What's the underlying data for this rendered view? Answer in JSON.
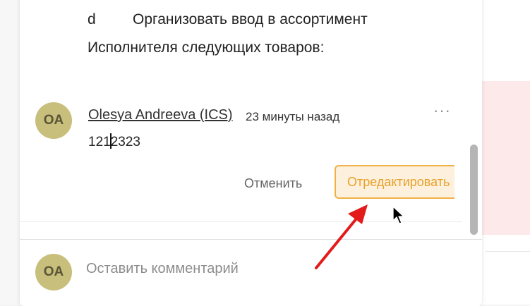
{
  "document": {
    "letter": "d",
    "task": "Организовать ввод в ассортимент",
    "line2": "Исполнителя следующих товаров:"
  },
  "comment": {
    "avatar_initials": "OA",
    "author": "Olesya Andreeva (ICS)",
    "time": "23 минуты назад",
    "more": "···",
    "edit_value_before_caret": "121",
    "edit_value_after_caret": "2323"
  },
  "actions": {
    "cancel_label": "Отменить",
    "edit_label": "Отредактировать"
  },
  "new_comment": {
    "avatar_initials": "OA",
    "placeholder": "Оставить комментарий"
  },
  "colors": {
    "accent": "#f0b14a",
    "accent_text": "#e8a12c",
    "avatar_bg": "#c8bf7c",
    "annotation_arrow": "#e31b1b"
  },
  "icons": [
    "more-options-icon",
    "mouse-cursor-icon",
    "annotation-arrow-icon"
  ]
}
